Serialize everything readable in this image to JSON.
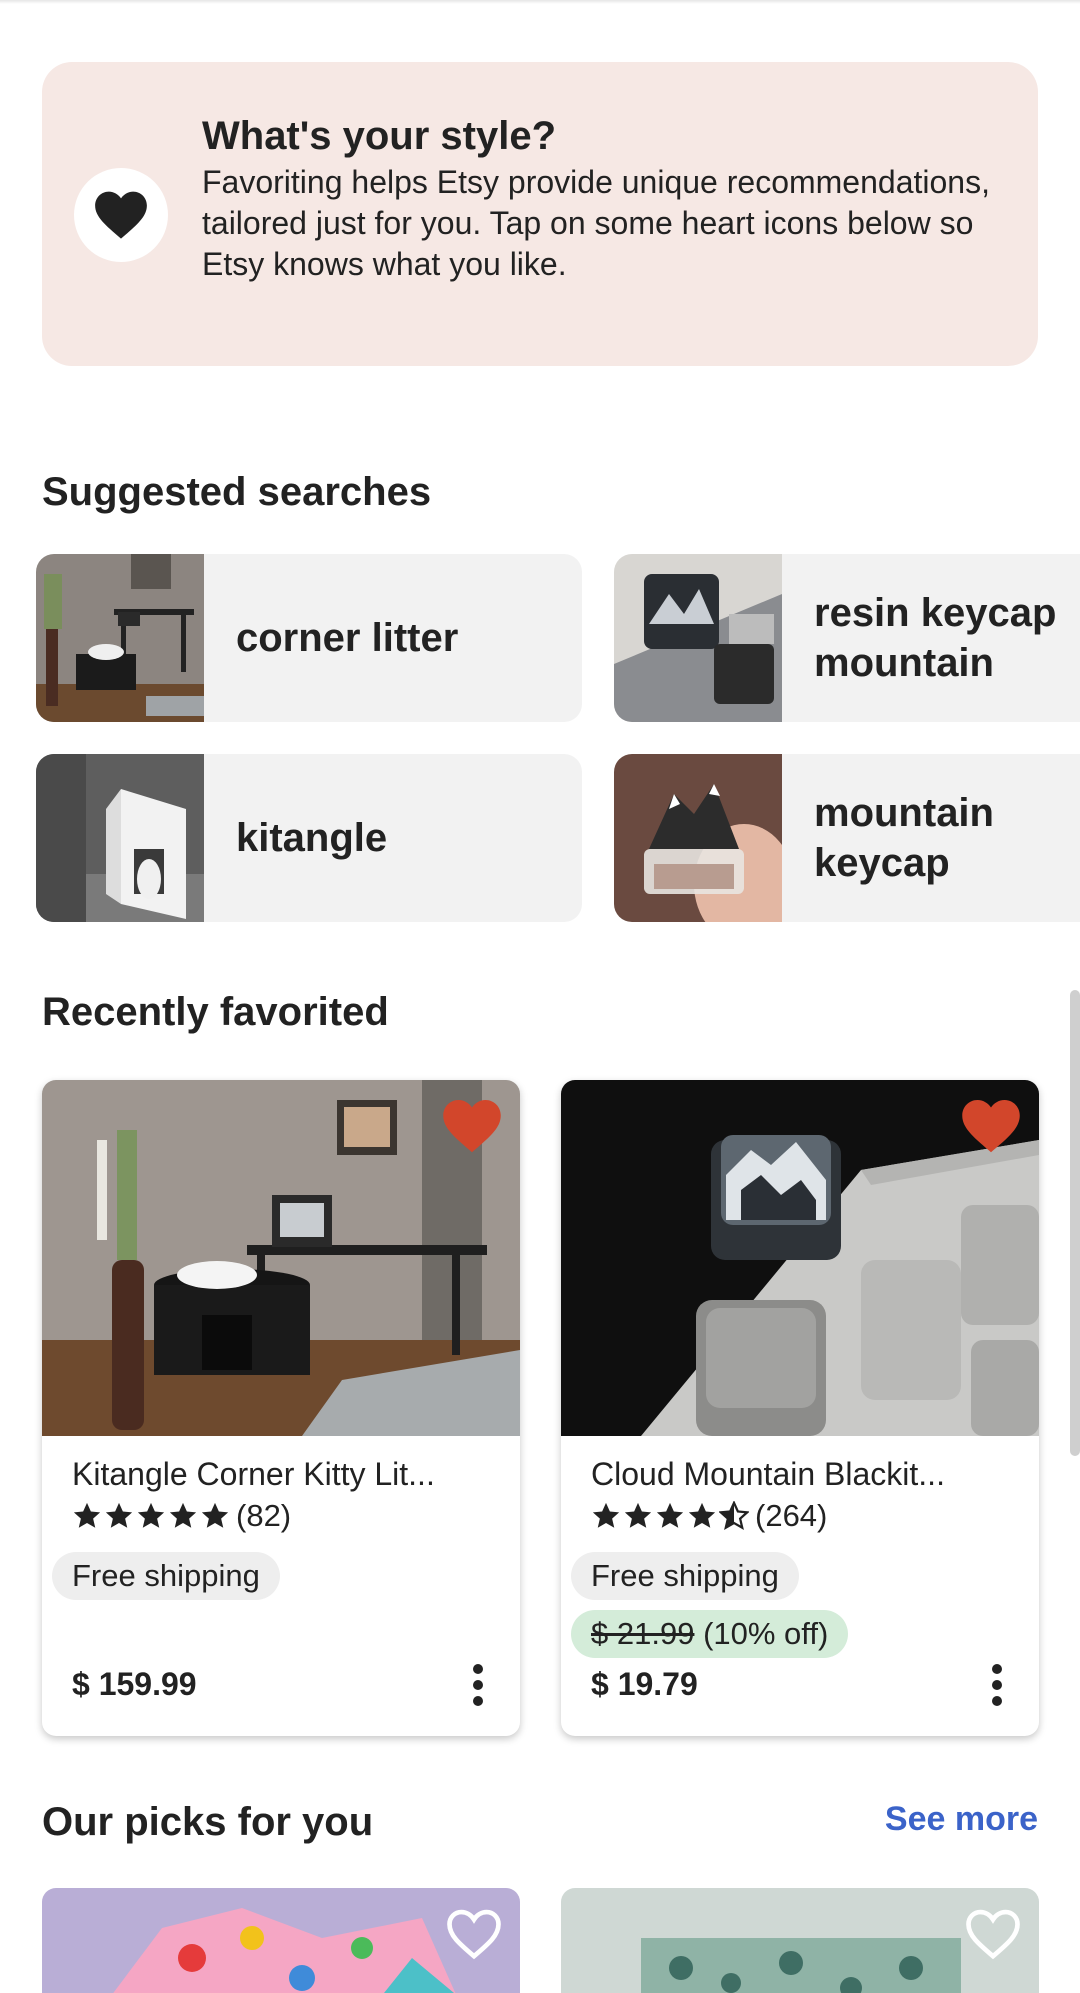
{
  "style_prompt": {
    "title": "What's your style?",
    "body": "Favoriting helps Etsy provide unique recommendations, tailored just for you. Tap on some heart icons below so Etsy knows what you like.",
    "icon": "heart-icon"
  },
  "suggested_searches": {
    "title": "Suggested searches",
    "items": [
      {
        "label": "corner litter"
      },
      {
        "label": "resin keycap mountain"
      },
      {
        "label": "kitangle"
      },
      {
        "label": "mountain keycap"
      }
    ]
  },
  "recently_favorited": {
    "title": "Recently favorited",
    "items": [
      {
        "title": "Kitangle Corner Kitty Lit...",
        "rating": 5,
        "reviews": "(82)",
        "shipping": "Free shipping",
        "price": "$ 159.99",
        "favorited": true
      },
      {
        "title": "Cloud Mountain Blackit...",
        "rating": 4.5,
        "reviews": "(264)",
        "shipping": "Free shipping",
        "original_price": "$ 21.99",
        "discount": "(10% off)",
        "price": "$ 19.79",
        "favorited": true
      }
    ]
  },
  "our_picks": {
    "title": "Our picks for you",
    "see_more": "See more"
  },
  "colors": {
    "banner_bg": "#f6e8e4",
    "favorite_heart": "#d2462b",
    "link_blue": "#3b63c9",
    "sale_badge": "#d4ecd9"
  }
}
